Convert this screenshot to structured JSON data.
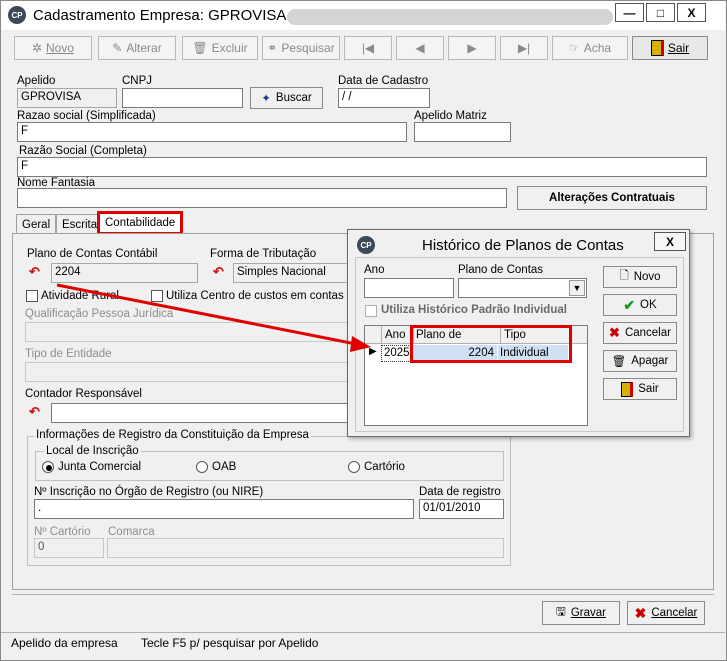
{
  "window": {
    "title": "Cadastramento Empresa: GPROVISA -",
    "icon_text": "CP",
    "minimize": "—",
    "maximize": "□",
    "close": "X"
  },
  "toolbar": {
    "novo": "Novo",
    "alterar": "Alterar",
    "excluir": "Excluir",
    "pesquisar": "Pesquisar",
    "acha": "Acha",
    "sair": "Sair",
    "nav_first": "|◀",
    "nav_prev": "◀",
    "nav_next": "▶",
    "nav_last": "▶|"
  },
  "form": {
    "apelido_label": "Apelido",
    "apelido_value": "GPROVISA",
    "cnpj_label": "CNPJ",
    "cnpj_value": "",
    "buscar": "Buscar",
    "data_cadastro_label": "Data de Cadastro",
    "data_cadastro_value": " /  /",
    "razao_simplificada_label": "Razao social (Simplificada)",
    "razao_simplificada_value": "F",
    "apelido_matriz_label": "Apelido Matriz",
    "apelido_matriz_value": "",
    "razao_completa_label": "Razão Social (Completa)",
    "razao_completa_value": "F",
    "nome_fantasia_label": "Nome Fantasia",
    "nome_fantasia_value": "",
    "alteracoes_button": "Alterações Contratuais"
  },
  "tabs": [
    "Geral",
    "Escrita",
    "Contabilidade"
  ],
  "contabilidade": {
    "plano_contas_label": "Plano de Contas Contábil",
    "plano_contas_value": "2204",
    "forma_tributacao_label": "Forma de Tributação",
    "forma_tributacao_value": "Simples Nacional",
    "atividade_rural_label": "Atividade Rural",
    "centro_custos_label": "Utiliza Centro de custos em contas Pat",
    "qualificacao_label": "Qualificação Pessoa Jurídica",
    "tipo_entidade_label": "Tipo de Entidade",
    "contador_label": "Contador Responsável",
    "registro_group_label": "Informações de Registro da Constituição da Empresa",
    "local_inscricao_label": "Local de Inscrição",
    "radio_junta": "Junta Comercial",
    "radio_oab": "OAB",
    "radio_cartorio": "Cartório",
    "nire_label": "Nº Inscrição no Órgão de Registro (ou NIRE)",
    "nire_value": ".",
    "data_registro_label": "Data de registro",
    "data_registro_value": "01/01/2010",
    "n_cartorio_label": "Nº Cartório",
    "n_cartorio_value": "0",
    "comarca_label": "Comarca",
    "comarca_value": ""
  },
  "dialog": {
    "title": "Histórico de Planos de Contas",
    "icon_text": "CP",
    "close": "X",
    "ano_label": "Ano",
    "plano_label": "Plano de Contas",
    "utiliza_label": "Utiliza Histórico Padrão Individual",
    "grid_headers": [
      "Ano",
      "Plano de Contas",
      "Tipo"
    ],
    "grid_rows": [
      {
        "ano": "2025",
        "plano": "2204",
        "tipo": "Individual"
      }
    ],
    "btn_novo": "Novo",
    "btn_ok": "OK",
    "btn_cancelar": "Cancelar",
    "btn_apagar": "Apagar",
    "btn_sair": "Sair"
  },
  "footer": {
    "gravar": "Gravar",
    "cancelar": "Cancelar"
  },
  "status": {
    "left": "Apelido da empresa",
    "right": "Tecle F5 p/ pesquisar por Apelido"
  },
  "colors": {
    "annotation_red": "#e00000",
    "selected_row": "#cfe0f5"
  }
}
